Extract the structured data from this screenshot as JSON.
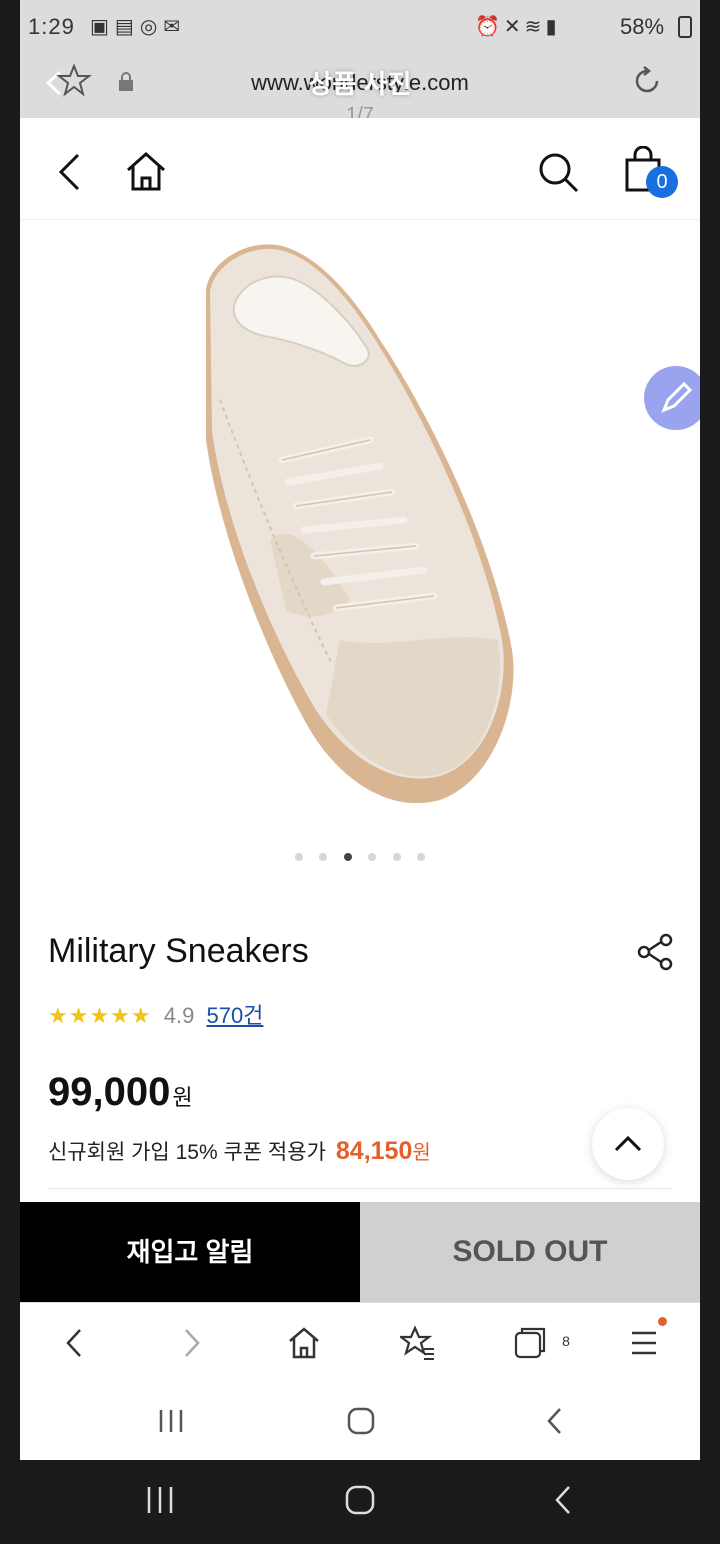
{
  "status_bar": {
    "time": "1:29",
    "left_icons": [
      "notification-icon",
      "gallery-icon",
      "media-icon",
      "message-icon"
    ],
    "right_icons": [
      "alarm-icon",
      "mute-icon",
      "wifi-icon",
      "signal-icon"
    ],
    "battery": "58%"
  },
  "browser": {
    "url": "www.wonderstyle.com",
    "overlay_title": "상품 사진",
    "image_counter": "1/7"
  },
  "site_header": {
    "cart_count": "0"
  },
  "colors": {
    "cart_badge": "#1a6fe0",
    "coupon_price": "#e4602a",
    "rating_stars": "#f0c419",
    "review_link": "#1a4ea8",
    "restock_button_bg": "#000000",
    "soldout_button_bg": "#d0d0d0",
    "float_button": "#9aa4ee"
  },
  "carousel": {
    "dot_count": 6,
    "active_index": 2
  },
  "product": {
    "title": "Military Sneakers",
    "rating_stars": "★★★★★",
    "rating": 4.9,
    "rating_score": "4.9",
    "review_count": "570건",
    "price": "99,000",
    "price_unit": "원",
    "coupon_label": "신규회원 가입 15% 쿠폰 적용가",
    "coupon_price": "84,150",
    "coupon_unit": "원"
  },
  "actions": {
    "restock_label": "재입고 알림",
    "soldout_label": "SOLD OUT"
  },
  "browser_toolbar": {
    "tabs_count": "8"
  }
}
